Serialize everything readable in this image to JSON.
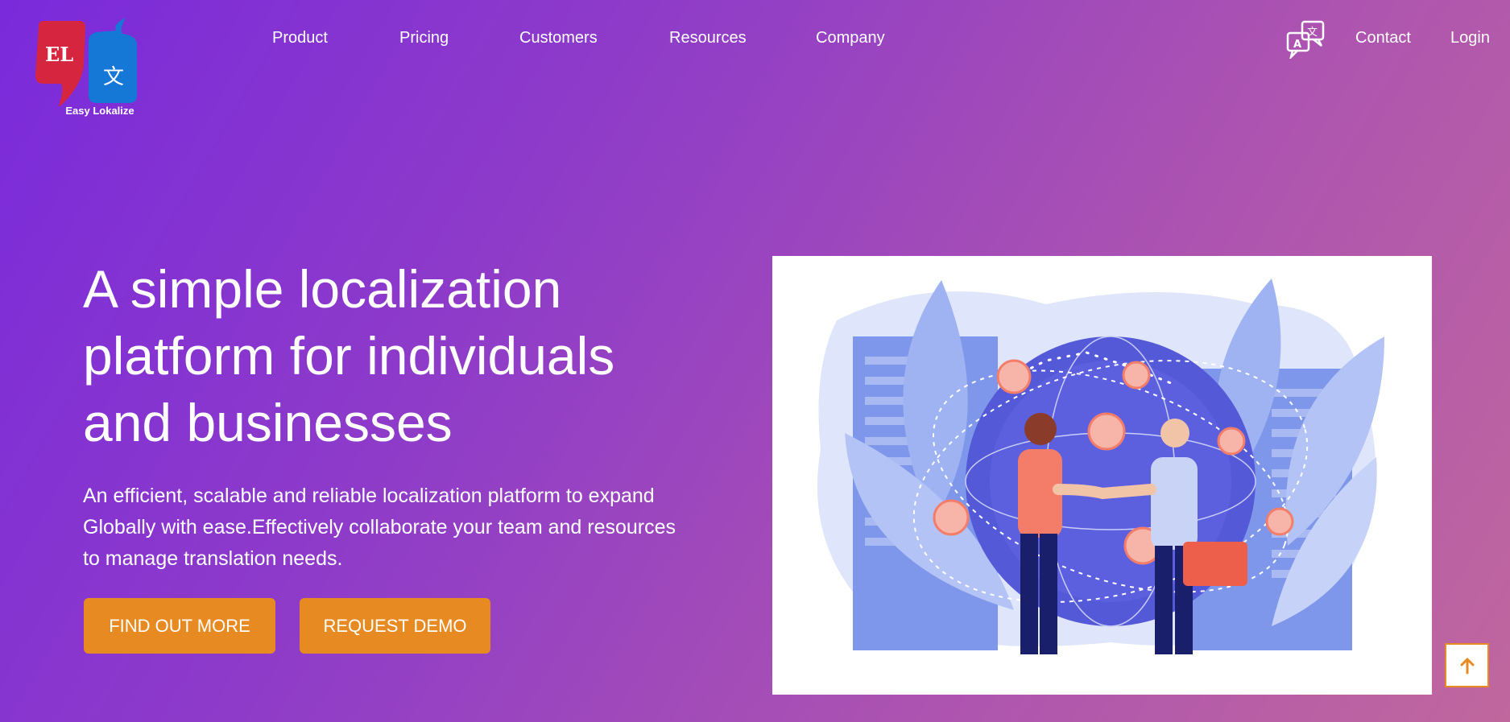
{
  "brand": {
    "name": "Easy Lokalize",
    "logo_left_text": "EL",
    "logo_right_glyph": "文"
  },
  "nav": {
    "items": [
      {
        "label": "Product"
      },
      {
        "label": "Pricing"
      },
      {
        "label": "Customers"
      },
      {
        "label": "Resources"
      },
      {
        "label": "Company"
      }
    ],
    "right": {
      "translate_icon": "translate-icon",
      "contact": "Contact",
      "login": "Login"
    }
  },
  "hero": {
    "title_lines": [
      "A simple localization",
      "platform for individuals",
      "and businesses"
    ],
    "description_lines": [
      "An efficient, scalable and reliable localization platform to expand",
      "Globally with ease.Effectively collaborate your team and resources",
      "to manage translation needs."
    ],
    "buttons": {
      "find_out_more": "FIND OUT MORE",
      "request_demo": "REQUEST DEMO"
    }
  },
  "colors": {
    "accent": "#e88a22",
    "gradient_start": "#7a2adb",
    "gradient_end": "#c0679e",
    "logo_red": "#d6253f",
    "logo_blue": "#1577d6"
  },
  "icons": {
    "back_to_top": "arrow-up-icon",
    "translate": "translate-icon"
  }
}
